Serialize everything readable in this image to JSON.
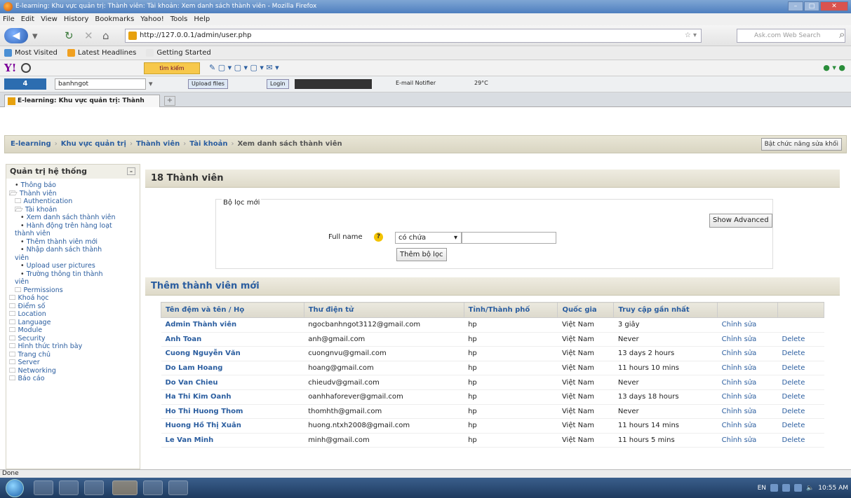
{
  "window": {
    "title": "E-learning: Khu vực quản trị: Thành viên: Tài khoản: Xem danh sách thành viên - Mozilla Firefox"
  },
  "menu": [
    "File",
    "Edit",
    "View",
    "History",
    "Bookmarks",
    "Yahoo!",
    "Tools",
    "Help"
  ],
  "nav": {
    "url": "http://127.0.0.1/admin/user.php",
    "search_placeholder": "Ask.com Web Search"
  },
  "bookmarks": [
    "Most Visited",
    "Latest Headlines",
    "Getting Started"
  ],
  "yahoo": {
    "search_label": "tìm kiếm"
  },
  "toolbar2": {
    "four_label": "4",
    "user": "banhngot",
    "upload": "Upload files",
    "login": "Login",
    "email": "E-mail Notifier",
    "weather": "29°C"
  },
  "tab": {
    "label": "E-learning: Khu vực quản trị: Thành vi..."
  },
  "crumbs": [
    "E-learning",
    "Khu vực quản trị",
    "Thành viên",
    "Tài khoản",
    "Xem danh sách thành viên"
  ],
  "edit_button": "Bật chức năng sửa khối",
  "sidebar": {
    "title": "Quản trị hệ thống",
    "items": [
      {
        "label": "Thông báo",
        "level": 1,
        "bullet": "•"
      },
      {
        "label": "Thành viên",
        "level": 0,
        "bullet": "🗁"
      },
      {
        "label": "Authentication",
        "level": 1,
        "bullet": "🗀"
      },
      {
        "label": "Tài khoản",
        "level": 1,
        "bullet": "🗁"
      },
      {
        "label": "Xem danh sách thành viên",
        "level": 2,
        "bullet": "•"
      },
      {
        "label": "Hành động trên hàng loạt",
        "level": 2,
        "bullet": "•"
      },
      {
        "label": "thành viên",
        "level": 1,
        "bullet": ""
      },
      {
        "label": "Thêm thành viên mới",
        "level": 2,
        "bullet": "•"
      },
      {
        "label": "Nhập danh sách thành",
        "level": 2,
        "bullet": "•"
      },
      {
        "label": "viên",
        "level": 1,
        "bullet": ""
      },
      {
        "label": "Upload user pictures",
        "level": 2,
        "bullet": "•"
      },
      {
        "label": "Trường thông tin thành",
        "level": 2,
        "bullet": "•"
      },
      {
        "label": "viên",
        "level": 1,
        "bullet": ""
      },
      {
        "label": "Permissions",
        "level": 1,
        "bullet": "🗀"
      },
      {
        "label": "Khoá học",
        "level": 0,
        "bullet": "🗀"
      },
      {
        "label": "Điểm số",
        "level": 0,
        "bullet": "🗀"
      },
      {
        "label": "Location",
        "level": 0,
        "bullet": "🗀"
      },
      {
        "label": "Language",
        "level": 0,
        "bullet": "🗀"
      },
      {
        "label": "Module",
        "level": 0,
        "bullet": "🗀"
      },
      {
        "label": "Security",
        "level": 0,
        "bullet": "🗀"
      },
      {
        "label": "Hình thức trình bày",
        "level": 0,
        "bullet": "🗀"
      },
      {
        "label": "Trang chủ",
        "level": 0,
        "bullet": "🗀"
      },
      {
        "label": "Server",
        "level": 0,
        "bullet": "🗀"
      },
      {
        "label": "Networking",
        "level": 0,
        "bullet": "🗀"
      },
      {
        "label": "Báo cáo",
        "level": 0,
        "bullet": "🗀"
      }
    ]
  },
  "main": {
    "count_heading": "18 Thành viên",
    "filter": {
      "legend": "Bộ lọc mới",
      "field_label": "Full name",
      "operator": "có chứa",
      "value": "",
      "add_button": "Thêm bộ lọc",
      "advanced_button": "Show Advanced"
    },
    "add_heading": "Thêm thành viên mới",
    "table": {
      "headers": [
        "Tên đệm và tên / Họ",
        "Thư điện tử",
        "Tỉnh/Thành phố",
        "Quốc gia",
        "Truy cập gần nhất",
        "",
        ""
      ],
      "rows": [
        [
          "Admin Thành viên",
          "ngocbanhngot3112@gmail.com",
          "hp",
          "Việt Nam",
          "3 giây",
          "Chỉnh sửa",
          ""
        ],
        [
          "Anh Toan",
          "anh@gmail.com",
          "hp",
          "Việt Nam",
          "Never",
          "Chỉnh sửa",
          "Delete"
        ],
        [
          "Cuong Nguyễn Văn",
          "cuongnvu@gmail.com",
          "hp",
          "Việt Nam",
          "13 days 2 hours",
          "Chỉnh sửa",
          "Delete"
        ],
        [
          "Do Lam Hoang",
          "hoang@gmail.com",
          "hp",
          "Việt Nam",
          "11 hours 10 mins",
          "Chỉnh sửa",
          "Delete"
        ],
        [
          "Do Van Chieu",
          "chieudv@gmail.com",
          "hp",
          "Việt Nam",
          "Never",
          "Chỉnh sửa",
          "Delete"
        ],
        [
          "Ha Thi Kim Oanh",
          "oanhhaforever@gmail.com",
          "hp",
          "Việt Nam",
          "13 days 18 hours",
          "Chỉnh sửa",
          "Delete"
        ],
        [
          "Ho Thi Huong Thom",
          "thomhth@gmail.com",
          "hp",
          "Việt Nam",
          "Never",
          "Chỉnh sửa",
          "Delete"
        ],
        [
          "Huong Hồ Thị Xuân",
          "huong.ntxh2008@gmail.com",
          "hp",
          "Việt Nam",
          "11 hours 14 mins",
          "Chỉnh sửa",
          "Delete"
        ],
        [
          "Le Van Minh",
          "minh@gmail.com",
          "hp",
          "Việt Nam",
          "11 hours 5 mins",
          "Chỉnh sửa",
          "Delete"
        ]
      ]
    }
  },
  "status": "Done",
  "tray": {
    "lang": "EN",
    "time": "10:55 AM"
  }
}
